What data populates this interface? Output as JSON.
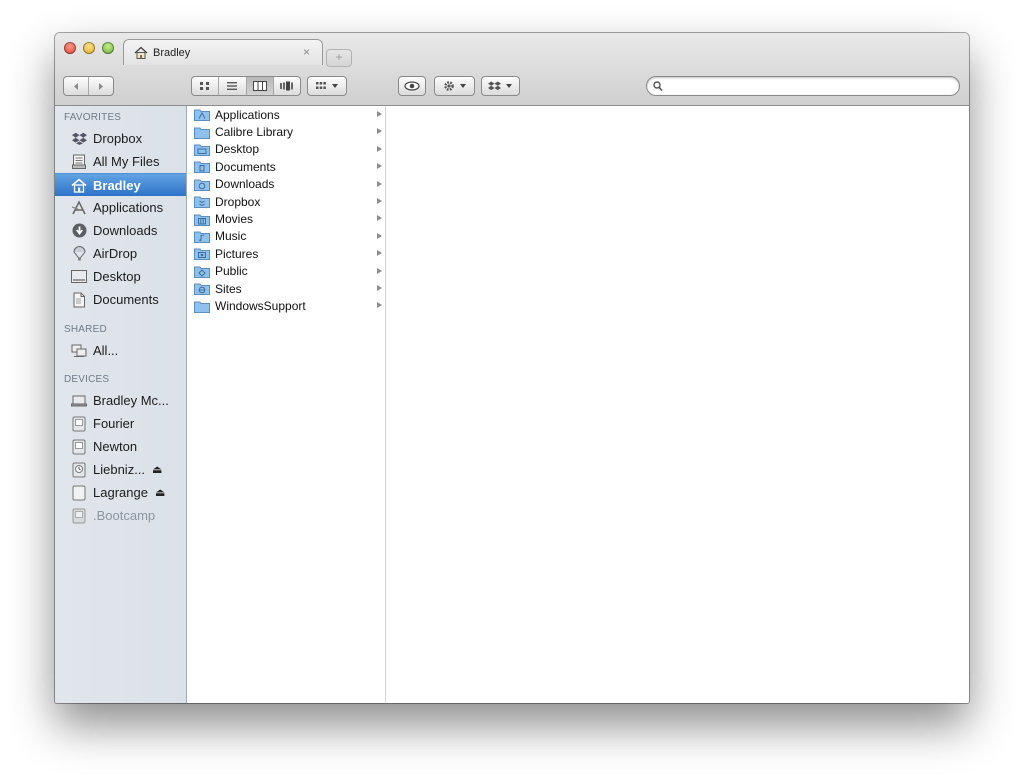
{
  "window": {
    "tab_title": "Bradley",
    "close_glyph": "×",
    "new_tab_glyph": "+"
  },
  "toolbar": {
    "back_icon": "back-arrow-icon",
    "forward_icon": "forward-arrow-icon",
    "views": [
      "icon-view",
      "list-view",
      "column-view",
      "coverflow-view"
    ],
    "active_view": "column-view",
    "search": {
      "value": "",
      "placeholder": ""
    }
  },
  "sidebar": {
    "favorites_label": "FAVORITES",
    "shared_label": "SHARED",
    "devices_label": "DEVICES",
    "favorites": [
      {
        "label": "Dropbox",
        "icon": "dropbox-icon"
      },
      {
        "label": "All My Files",
        "icon": "all-files-icon"
      },
      {
        "label": "Bradley",
        "icon": "home-icon",
        "selected": true
      },
      {
        "label": "Applications",
        "icon": "applications-icon"
      },
      {
        "label": "Downloads",
        "icon": "downloads-icon"
      },
      {
        "label": "AirDrop",
        "icon": "airdrop-icon"
      },
      {
        "label": "Desktop",
        "icon": "desktop-icon"
      },
      {
        "label": "Documents",
        "icon": "documents-icon"
      }
    ],
    "shared": [
      {
        "label": "All...",
        "icon": "network-icon"
      }
    ],
    "devices": [
      {
        "label": "Bradley Mc...",
        "icon": "laptop-icon"
      },
      {
        "label": "Fourier",
        "icon": "drive-icon"
      },
      {
        "label": "Newton",
        "icon": "drive-icon"
      },
      {
        "label": "Liebniz...",
        "icon": "time-machine-icon",
        "eject": true
      },
      {
        "label": "Lagrange",
        "icon": "external-drive-icon",
        "eject": true
      },
      {
        "label": ".Bootcamp",
        "icon": "drive-icon",
        "dimmed": true
      }
    ],
    "eject_glyph": "⏏"
  },
  "column1": {
    "items": [
      "Applications",
      "Calibre Library",
      "Desktop",
      "Documents",
      "Downloads",
      "Dropbox",
      "Movies",
      "Music",
      "Pictures",
      "Public",
      "Sites",
      "WindowsSupport"
    ]
  },
  "colors": {
    "selection": "#3a80d2",
    "folder": "#7fb7e6",
    "sidebar_bg": "#dde3ea"
  }
}
